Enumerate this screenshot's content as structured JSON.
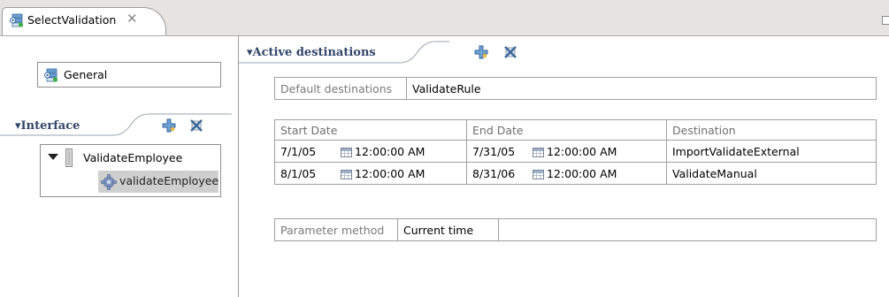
{
  "tab": {
    "title": "SelectValidation",
    "close_glyph": "✕"
  },
  "left": {
    "general_label": "General",
    "interface_header": "Interface",
    "tree": {
      "interface_name": "ValidateEmployee",
      "operation_name": "validateEmployee"
    }
  },
  "right": {
    "header": "Active destinations",
    "default_destinations": {
      "label": "Default destinations",
      "value": "ValidateRule"
    },
    "table": {
      "columns": [
        "Start Date",
        "End Date",
        "Destination"
      ],
      "rows": [
        {
          "start_date": "7/1/05",
          "start_time": "12:00:00 AM",
          "end_date": "7/31/05",
          "end_time": "12:00:00 AM",
          "destination": "ImportValidateExternal"
        },
        {
          "start_date": "8/1/05",
          "start_time": "12:00:00 AM",
          "end_date": "8/31/06",
          "end_time": "12:00:00 AM",
          "destination": "ValidateManual"
        }
      ]
    },
    "parameter_method": {
      "label": "Parameter method",
      "value": "Current time"
    }
  },
  "icons": {
    "tab": "selector-component-icon",
    "general": "selector-component-icon",
    "add": "add-icon",
    "remove": "remove-icon",
    "interface": "interface-icon",
    "operation": "operation-gear-icon",
    "calendar": "calendar-icon"
  }
}
